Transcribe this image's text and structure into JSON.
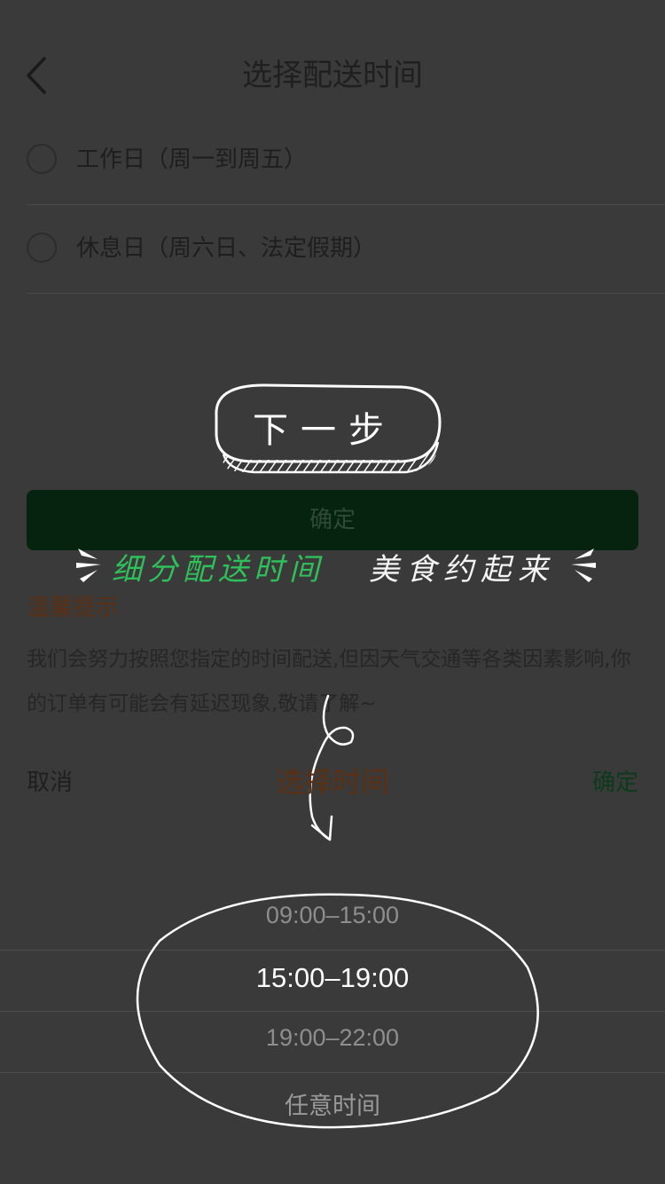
{
  "header": {
    "title": "选择配送时间"
  },
  "options": [
    {
      "label": "工作日（周一到周五）",
      "selected": false
    },
    {
      "label": "休息日（周六日、法定假期）",
      "selected": false
    }
  ],
  "next_step": {
    "label": "下一步"
  },
  "confirm_bar": {
    "label": "确定"
  },
  "banner": {
    "green_text": "细分配送时间",
    "white_text": "美食约起来"
  },
  "tips": {
    "title": "温馨提示",
    "body": "我们会努力按照您指定的时间配送,但因天气交通等各类因素影响,你的订单有可能会有延迟现象,敬请了解~"
  },
  "picker": {
    "cancel_label": "取消",
    "title": "选择时间",
    "confirm_label": "确定",
    "slots": [
      "09:00–15:00",
      "15:00–19:00",
      "19:00–22:00",
      "任意时间"
    ],
    "selected_index": 1
  },
  "colors": {
    "background": "#3a3a3a",
    "confirm_bar": "#06230f",
    "accent_orange": "#5a2f12",
    "banner_green": "#2fbf5b"
  },
  "icons": [
    "back-icon",
    "radio-icon",
    "arrow-doodle-icon",
    "spark-icon"
  ]
}
